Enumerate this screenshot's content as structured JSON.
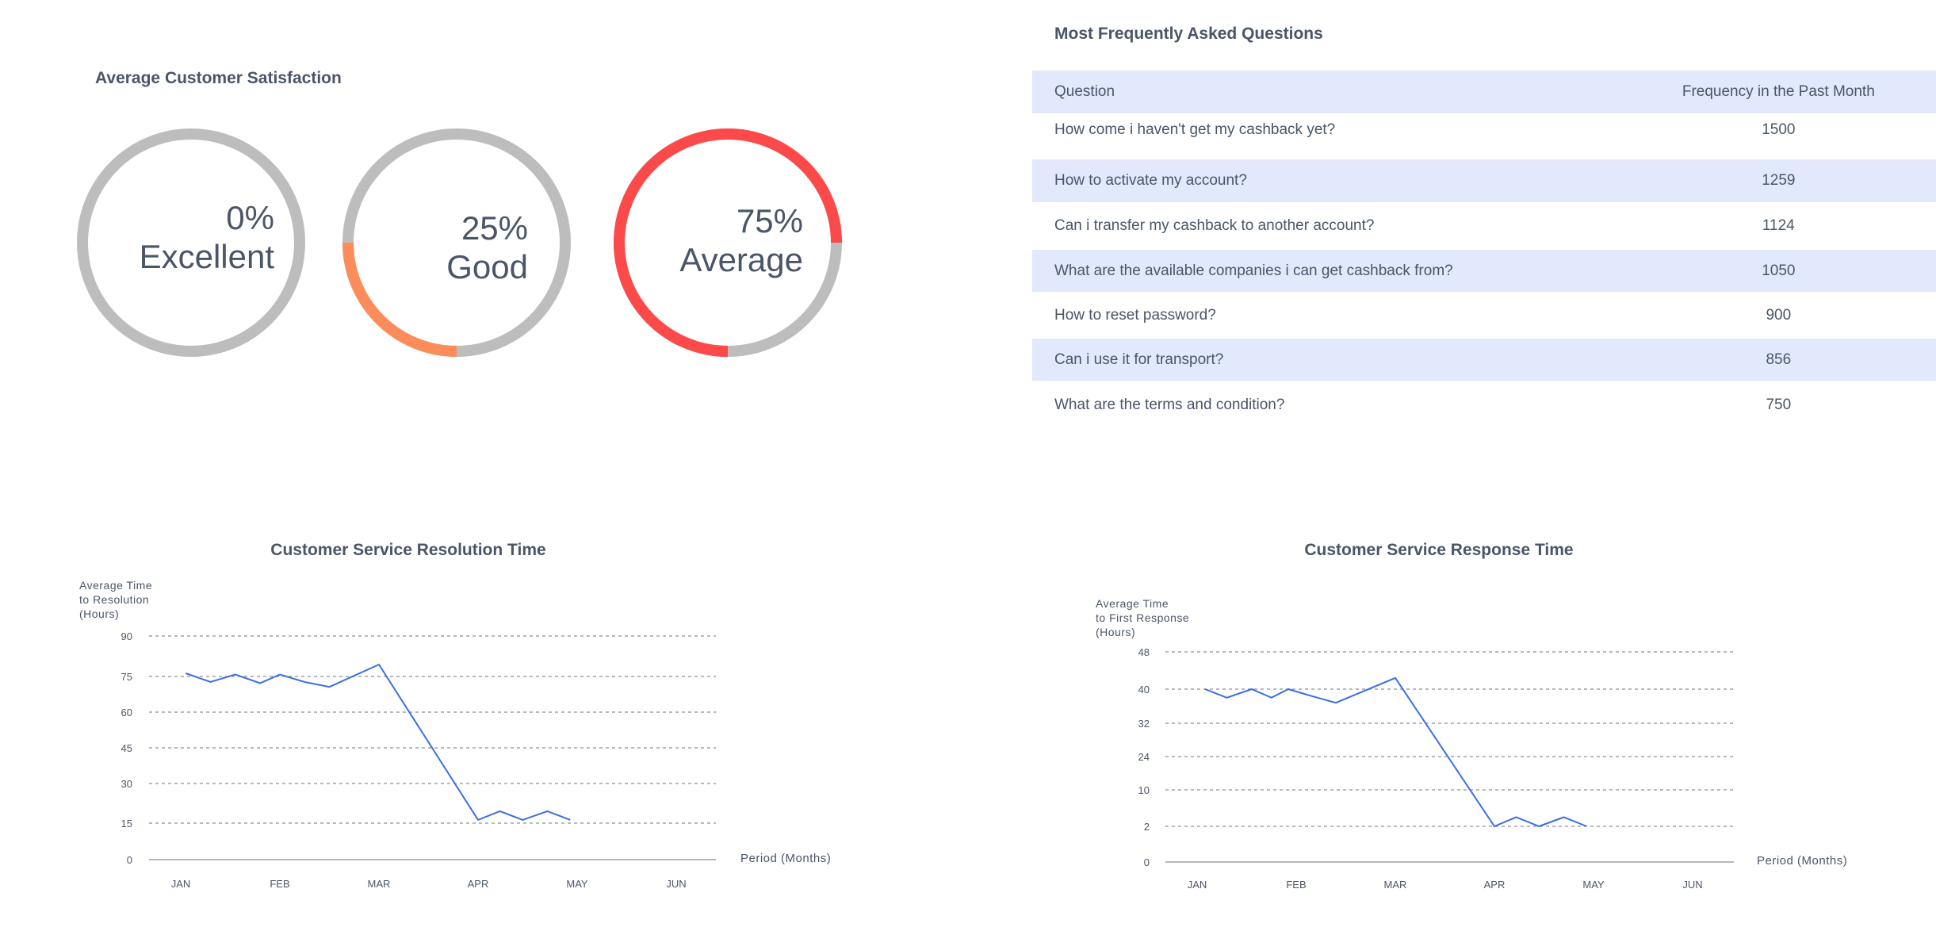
{
  "satisfaction": {
    "title": "Average Customer Satisfaction",
    "gauges": [
      {
        "percent_text": "0%",
        "label": "Excellent",
        "value": 0,
        "color": "#c0c0c0"
      },
      {
        "percent_text": "25%",
        "label": "Good",
        "value": 25,
        "color": "#fc8d5b"
      },
      {
        "percent_text": "75%",
        "label": "Average",
        "value": 75,
        "color": "#fc4a4a"
      }
    ],
    "track_color": "#bdbdbd"
  },
  "faq": {
    "title": "Most Frequently Asked Questions",
    "header": {
      "question": "Question",
      "frequency": "Frequency in the Past Month"
    },
    "rows": [
      {
        "question": "How come i haven't get my cashback yet?",
        "frequency": "1500"
      },
      {
        "question": "How to activate my account?",
        "frequency": "1259"
      },
      {
        "question": "Can i transfer my cashback to another account?",
        "frequency": "1124"
      },
      {
        "question": "What are the available companies i can get cashback from?",
        "frequency": "1050"
      },
      {
        "question": "How to reset password?",
        "frequency": "900"
      },
      {
        "question": "Can i use it for transport?",
        "frequency": "856"
      },
      {
        "question": "What are the terms and condition?",
        "frequency": "750"
      }
    ],
    "band_color": "#e3e9fd"
  },
  "chart_data": [
    {
      "type": "line",
      "title": "Customer Service Resolution Time",
      "ylabel_lines": [
        "Average Time",
        "to Resolution",
        "(Hours)"
      ],
      "xlabel": "Period (Months)",
      "categories": [
        "JAN",
        "FEB",
        "MAR",
        "APR",
        "MAY",
        "JUN"
      ],
      "yticks": [
        "0",
        "15",
        "30",
        "45",
        "60",
        "75",
        "90"
      ],
      "ylim": [
        0,
        90
      ],
      "grid": true,
      "line_color": "#3b6ee6",
      "series": [
        {
          "x": [
            0.05,
            0.3,
            0.55,
            0.8,
            1.0,
            1.25,
            1.5,
            2.0,
            3.0,
            3.22,
            3.45,
            3.7,
            3.93
          ],
          "values": [
            75,
            71.5,
            74.5,
            71,
            74.5,
            71.5,
            69.5,
            78.5,
            16,
            19.5,
            16,
            19.5,
            16
          ]
        }
      ]
    },
    {
      "type": "line",
      "title": "Customer Service Response Time",
      "ylabel_lines": [
        "Average Time",
        "to First Response",
        "(Hours)"
      ],
      "xlabel": "Period (Months)",
      "categories": [
        "JAN",
        "FEB",
        "MAR",
        "APR",
        "MAY",
        "JUN"
      ],
      "yticks": [
        "0",
        "2",
        "10",
        "24",
        "32",
        "40",
        "48"
      ],
      "grid": true,
      "line_color": "#3b6ee6",
      "series": [
        {
          "x": [
            0.08,
            0.3,
            0.55,
            0.75,
            0.92,
            1.15,
            1.4,
            2.0,
            3.0,
            3.22,
            3.45,
            3.7,
            3.93
          ],
          "tick_index": [
            5.0,
            4.75,
            5.0,
            4.75,
            5.0,
            4.8,
            4.6,
            5.3,
            1.0,
            1.25,
            1.0,
            1.25,
            1.0
          ]
        }
      ]
    }
  ]
}
